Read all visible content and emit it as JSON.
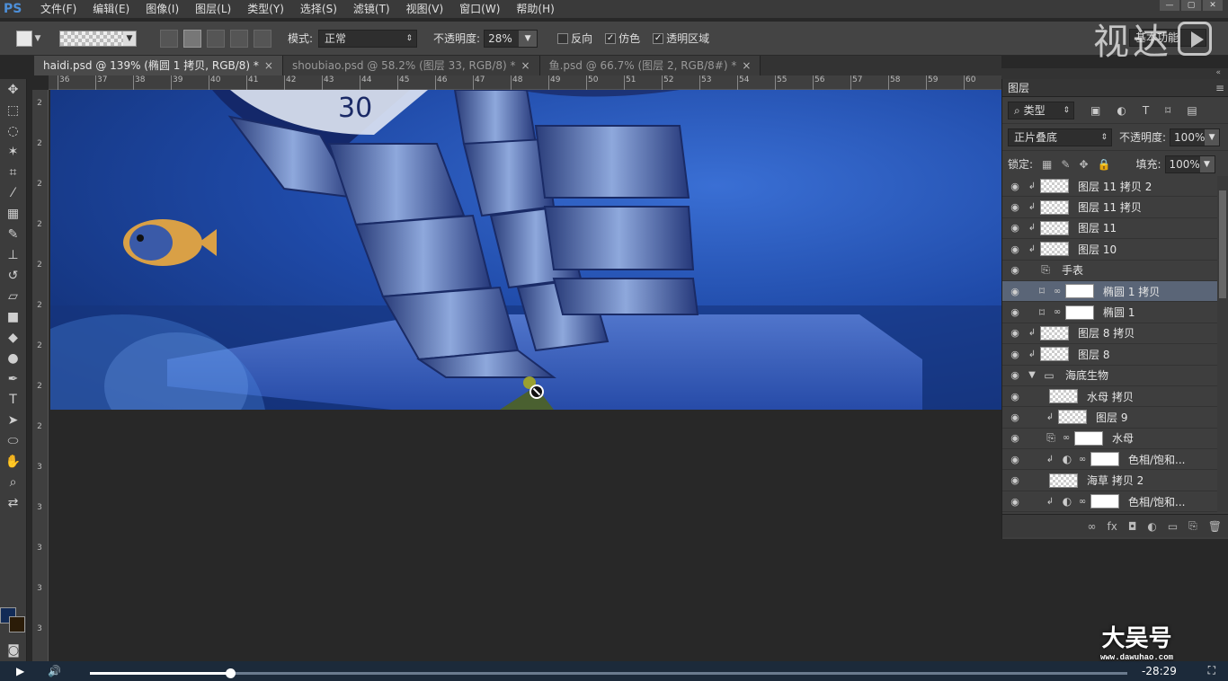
{
  "app": {
    "logo": "PS"
  },
  "menu": [
    "文件(F)",
    "编辑(E)",
    "图像(I)",
    "图层(L)",
    "类型(Y)",
    "选择(S)",
    "滤镜(T)",
    "视图(V)",
    "窗口(W)",
    "帮助(H)"
  ],
  "watermark_top": "视达",
  "options": {
    "mode_label": "模式:",
    "mode_value": "正常",
    "opacity_label": "不透明度:",
    "opacity_value": "28%",
    "reverse_label": "反向",
    "dither_label": "仿色",
    "transparency_label": "透明区域",
    "workspace": "基本功能"
  },
  "tabs": [
    {
      "label": "haidi.psd @ 139% (椭圆 1 拷贝, RGB/8) *",
      "close": "×"
    },
    {
      "label": "shoubiao.psd @ 58.2% (图层 33, RGB/8) *",
      "close": "×"
    },
    {
      "label": "鱼.psd @ 66.7% (图层 2, RGB/8#) *",
      "close": "×"
    }
  ],
  "ruler_h": [
    "36",
    "37",
    "38",
    "39",
    "40",
    "41",
    "42",
    "43",
    "44",
    "45",
    "46",
    "47",
    "48",
    "49",
    "50",
    "51",
    "52",
    "53",
    "54",
    "55",
    "56",
    "57",
    "58",
    "59",
    "60"
  ],
  "ruler_v": [
    "2",
    "2",
    "2",
    "2",
    "2",
    "2",
    "2",
    "2",
    "2",
    "3",
    "3",
    "3",
    "3",
    "3"
  ],
  "layers": {
    "tab": "图层",
    "kind_filter": "类型",
    "blend_mode": "正片叠底",
    "opacity_label": "不透明度:",
    "opacity_value": "100%",
    "lock_label": "锁定:",
    "fill_label": "填充:",
    "fill_value": "100%",
    "items": [
      {
        "name": "图层 11 拷贝 2"
      },
      {
        "name": "图层 11 拷贝"
      },
      {
        "name": "图层 11"
      },
      {
        "name": "图层 10"
      },
      {
        "name": "手表"
      },
      {
        "name": "椭圆 1 拷贝",
        "selected": true
      },
      {
        "name": "椭圆 1"
      },
      {
        "name": "图层 8 拷贝"
      },
      {
        "name": "图层 8"
      },
      {
        "name": "海底生物"
      },
      {
        "name": "水母 拷贝"
      },
      {
        "name": "图层 9"
      },
      {
        "name": "水母"
      },
      {
        "name": "色相/饱和..."
      },
      {
        "name": "海草 拷贝 2"
      },
      {
        "name": "色相/饱和..."
      }
    ]
  },
  "video": {
    "time_remaining": "-28:29",
    "progress": 0.135
  },
  "watermark_bottom": {
    "big": "大吴号",
    "small": "www.dawuhao.com"
  }
}
